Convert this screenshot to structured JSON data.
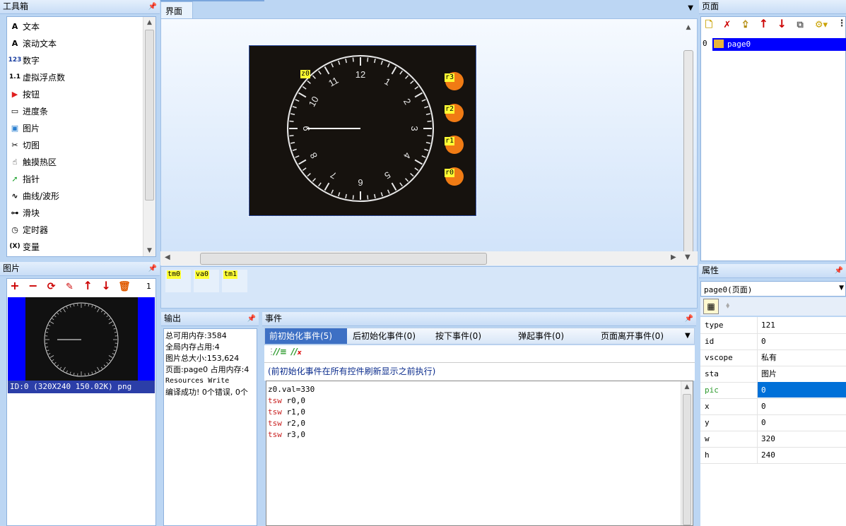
{
  "toolbox": {
    "title": "工具箱",
    "items": [
      {
        "icon": "text-icon",
        "glyph": "A",
        "label": "文本"
      },
      {
        "icon": "scrolling-text-icon",
        "glyph": "A",
        "label": "滚动文本"
      },
      {
        "icon": "number-icon",
        "glyph": "123",
        "label": "数字"
      },
      {
        "icon": "float-icon",
        "glyph": "1.1",
        "label": "虚拟浮点数"
      },
      {
        "icon": "button-icon",
        "glyph": "▶",
        "label": "按钮"
      },
      {
        "icon": "progress-bar-icon",
        "glyph": "▭",
        "label": "进度条"
      },
      {
        "icon": "picture-icon",
        "glyph": "▣",
        "label": "图片"
      },
      {
        "icon": "crop-icon",
        "glyph": "✂",
        "label": "切图"
      },
      {
        "icon": "hotspot-icon",
        "glyph": "☝",
        "label": "触摸热区"
      },
      {
        "icon": "pointer-icon",
        "glyph": "➚",
        "label": "指针"
      },
      {
        "icon": "waveform-icon",
        "glyph": "∿",
        "label": "曲线/波形"
      },
      {
        "icon": "slider-icon",
        "glyph": "⊶",
        "label": "滑块"
      },
      {
        "icon": "timer-icon",
        "glyph": "◷",
        "label": "定时器"
      },
      {
        "icon": "variable-icon",
        "glyph": "(X)",
        "label": "变量"
      }
    ]
  },
  "pictures": {
    "title": "图片",
    "count": "1",
    "item_label": "ID:0  (320X240 150.02K) png"
  },
  "canvas": {
    "tab_label": "界面",
    "clock_numbers": [
      "12",
      "1",
      "2",
      "3",
      "4",
      "5",
      "6",
      "7",
      "8",
      "9",
      "10",
      "11"
    ],
    "tags": {
      "z0": "z0",
      "r0": "r0",
      "r1": "r1",
      "r2": "r2",
      "r3": "r3"
    },
    "timers": [
      "tm0",
      "va0",
      "tm1"
    ]
  },
  "output": {
    "title": "输出",
    "lines": [
      "总可用内存:3584",
      "全局内存占用:4",
      "图片总大小:153,624",
      "页面:page0 占用内存:4",
      "Resources Write",
      "编译成功! 0个错误, 0个"
    ]
  },
  "events": {
    "title": "事件",
    "tabs": [
      "前初始化事件(5)",
      "后初始化事件(0)",
      "按下事件(0)",
      "弹起事件(0)",
      "页面离开事件(0)"
    ],
    "description": "(前初始化事件在所有控件刷新显示之前执行)",
    "code": [
      {
        "kw": "",
        "rest": "z0.val=330"
      },
      {
        "kw": "tsw",
        "rest": " r0,0"
      },
      {
        "kw": "tsw",
        "rest": " r1,0"
      },
      {
        "kw": "tsw",
        "rest": " r2,0"
      },
      {
        "kw": "tsw",
        "rest": " r3,0"
      }
    ]
  },
  "pages": {
    "title": "页面",
    "items": [
      {
        "index": "0",
        "name": "page0"
      }
    ]
  },
  "properties": {
    "title": "属性",
    "selector": "page0(页面)",
    "rows": [
      {
        "key": "type",
        "value": "121"
      },
      {
        "key": "id",
        "value": "0"
      },
      {
        "key": "vscope",
        "value": "私有"
      },
      {
        "key": "sta",
        "value": "图片"
      },
      {
        "key": "pic",
        "value": "0"
      },
      {
        "key": "x",
        "value": "0"
      },
      {
        "key": "y",
        "value": "0"
      },
      {
        "key": "w",
        "value": "320"
      },
      {
        "key": "h",
        "value": "240"
      }
    ],
    "highlight_color": "#0070d8"
  }
}
